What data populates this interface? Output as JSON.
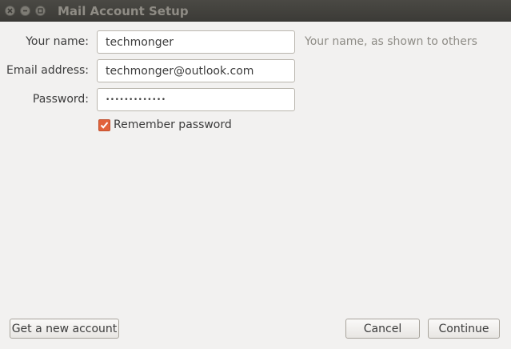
{
  "window": {
    "title": "Mail Account Setup"
  },
  "form": {
    "name_label": "Your name:",
    "name_value": "techmonger",
    "name_hint": "Your name, as shown to others",
    "email_label": "Email address:",
    "email_value": "techmonger@outlook.com",
    "password_label": "Password:",
    "password_value": "•••••••••••••",
    "remember_label": "Remember password",
    "remember_checked": true
  },
  "buttons": {
    "get_new_account": "Get a new account",
    "cancel": "Cancel",
    "continue": "Continue"
  },
  "colors": {
    "titlebar": "#3c3b37",
    "checkbox_accent": "#e2623a",
    "background": "#f2f1f0"
  }
}
